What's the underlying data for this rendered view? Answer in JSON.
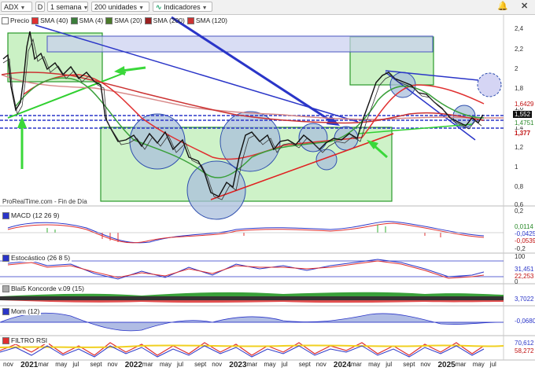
{
  "toolbar": {
    "ticker": "ADX",
    "d_label": "D",
    "period": "1 semana",
    "units": "200 unidades",
    "indicators": "Indicadores"
  },
  "legend": {
    "price": "Precio",
    "sma40": "SMA (40)",
    "sma4": "SMA (4)",
    "sma20": "SMA (20)",
    "sma200": "SMA (200)",
    "sma120": "SMA (120)"
  },
  "colors": {
    "sma40": "#e03030",
    "sma4": "#3b7d3b",
    "sma20": "#4a7a2a",
    "sma200": "#9a2020",
    "sma120": "#cc3333"
  },
  "source": "ProRealTime.com - Fin de Día",
  "price_axis": [
    "2,4",
    "2,2",
    "2",
    "1,8",
    "1,6",
    "1,4",
    "1,2",
    "1",
    "0,8",
    "0,6"
  ],
  "price_tags": {
    "p1": "1,6429",
    "p2": "1,552",
    "p3": "1,4751",
    "p4": "1,377"
  },
  "indicators": {
    "macd": {
      "label": "MACD (12 26 9)",
      "axis": [
        "0,2",
        "-0,2"
      ],
      "values": [
        "0,0114",
        "-0,0425",
        "-0,0539"
      ]
    },
    "stoch": {
      "label": "Estocástico (26 8 5)",
      "axis": [
        "100",
        "0"
      ],
      "values": [
        "31,451",
        "22,253"
      ]
    },
    "blai": {
      "label": "Blai5 Koncorde v.09 (15)",
      "values": [
        "3,7022"
      ]
    },
    "mom": {
      "label": "Mom (12)",
      "values": [
        "-0,0680"
      ]
    },
    "rsi": {
      "label": "FILTRO RSI",
      "values": [
        "70,612",
        "58,272"
      ]
    }
  },
  "time_axis": [
    {
      "t": "nov",
      "year": false
    },
    {
      "t": "2021",
      "year": true
    },
    {
      "t": "mar",
      "year": false
    },
    {
      "t": "may",
      "year": false
    },
    {
      "t": "jul",
      "year": false
    },
    {
      "t": "sept",
      "year": false
    },
    {
      "t": "nov",
      "year": false
    },
    {
      "t": "2022",
      "year": true
    },
    {
      "t": "mar",
      "year": false
    },
    {
      "t": "may",
      "year": false
    },
    {
      "t": "jul",
      "year": false
    },
    {
      "t": "sept",
      "year": false
    },
    {
      "t": "nov",
      "year": false
    },
    {
      "t": "2023",
      "year": true
    },
    {
      "t": "mar",
      "year": false
    },
    {
      "t": "may",
      "year": false
    },
    {
      "t": "jul",
      "year": false
    },
    {
      "t": "sept",
      "year": false
    },
    {
      "t": "nov",
      "year": false
    },
    {
      "t": "2024",
      "year": true
    },
    {
      "t": "mar",
      "year": false
    },
    {
      "t": "may",
      "year": false
    },
    {
      "t": "jul",
      "year": false
    },
    {
      "t": "sept",
      "year": false
    },
    {
      "t": "nov",
      "year": false
    },
    {
      "t": "2025",
      "year": true
    },
    {
      "t": "mar",
      "year": false
    },
    {
      "t": "may",
      "year": false
    },
    {
      "t": "jul",
      "year": false
    }
  ],
  "icons": [
    "chevron-down-icon",
    "bell-icon",
    "close-icon"
  ]
}
